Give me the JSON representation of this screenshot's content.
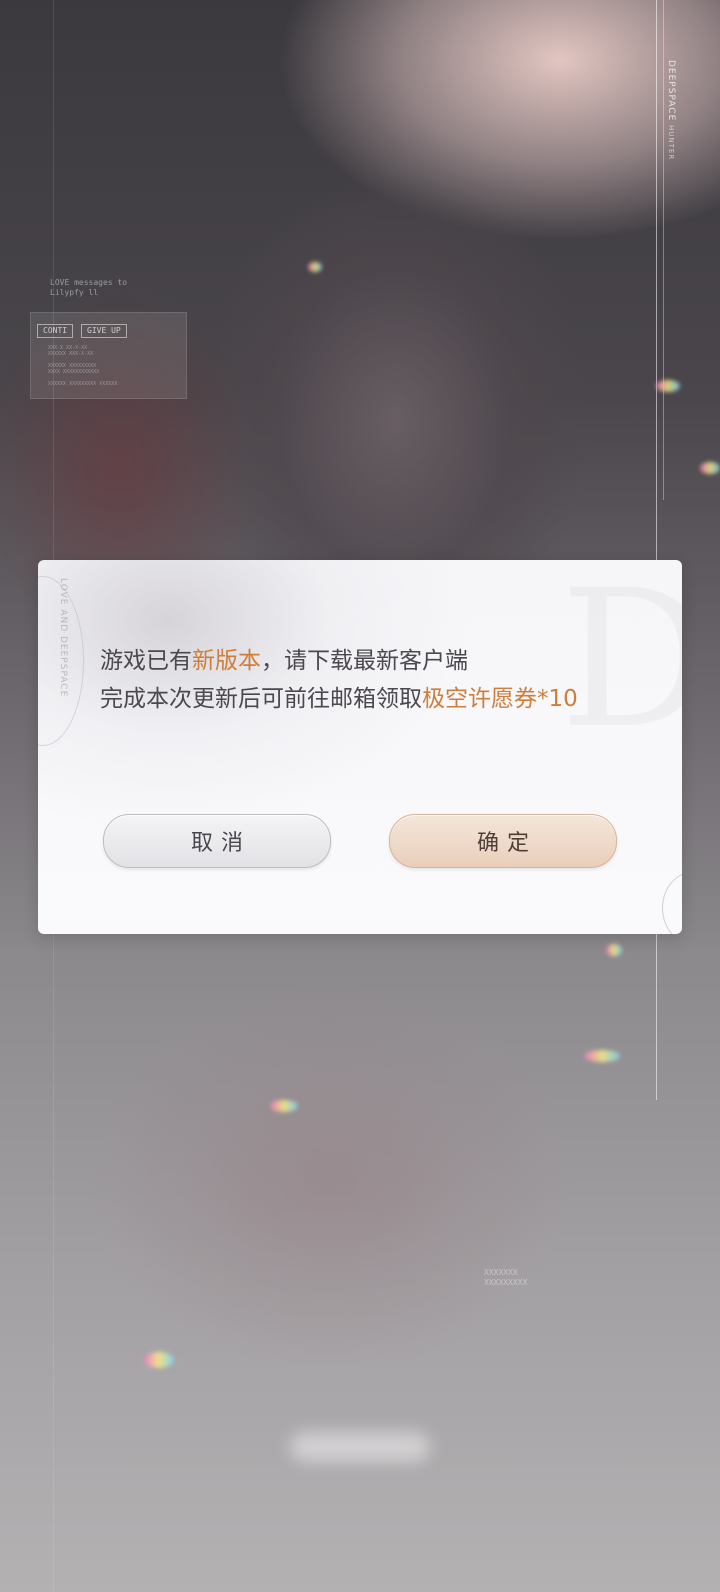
{
  "background": {
    "brand_vertical": "DEEPSPACE",
    "brand_vertical_sub": "HUNTER",
    "tag_1": "CONTI",
    "tag_2": "GIVE UP",
    "micro_top": "LOVE messages to\nLilypfy ll",
    "micro_panel": "XXX-X XX-X-XX\nXXXXXX XXX-X-XX\n\nXXXXXX XXXXXXXXX\nXXXX XXXXXXXXXXXX\n\nXXXXXX XXXXXXXXX XXXXXX",
    "micro_bottom": "XXXXXXX\nXXXXXXXXX"
  },
  "dialog": {
    "side_text": "LOVE AND DEEPSPACE",
    "line1_prefix": "游戏已有",
    "line1_highlight": "新版本",
    "line1_suffix": "，请下载最新客户端",
    "line2_prefix": "完成本次更新后可前往邮箱领取",
    "line2_highlight": "极空许愿券",
    "line2_suffix": "*10",
    "cancel_label": "取消",
    "confirm_label": "确定"
  },
  "colors": {
    "accent": "#cf7d3a",
    "text": "#4b4850",
    "confirm_fill": "#ecd5c3",
    "cancel_fill": "#e8e8eb"
  }
}
